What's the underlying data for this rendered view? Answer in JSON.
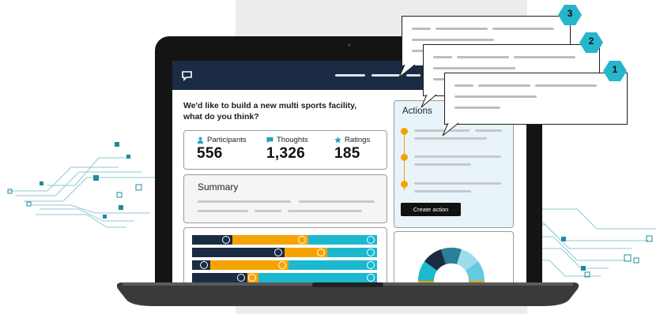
{
  "header": {},
  "survey": {
    "question_line1": "We'd like to build a new multi sports facility,",
    "question_line2": "what do you think?"
  },
  "stats": [
    {
      "label": "Participants",
      "value": "556",
      "icon": "person-icon"
    },
    {
      "label": "Thoughts",
      "value": "1,326",
      "icon": "speech-bubble-icon"
    },
    {
      "label": "Ratings",
      "value": "185",
      "icon": "star-icon"
    }
  ],
  "summary": {
    "title": "Summary"
  },
  "actions": {
    "title": "Actions",
    "button_label": "Create action"
  },
  "rating_bars": [
    {
      "navy": 0.22,
      "orange": 0.41,
      "teal": 0.37
    },
    {
      "navy": 0.5,
      "orange": 0.23,
      "teal": 0.27
    },
    {
      "navy": 0.1,
      "orange": 0.42,
      "teal": 0.48
    },
    {
      "navy": 0.3,
      "orange": 0.06,
      "teal": 0.64
    }
  ],
  "callouts": [
    {
      "number": "3"
    },
    {
      "number": "2"
    },
    {
      "number": "1"
    }
  ],
  "colors": {
    "navy": "#1b2b44",
    "orange": "#f5a300",
    "teal": "#1bb8d0",
    "badge": "#27b5cc",
    "circuit": "#2a8fa0"
  }
}
